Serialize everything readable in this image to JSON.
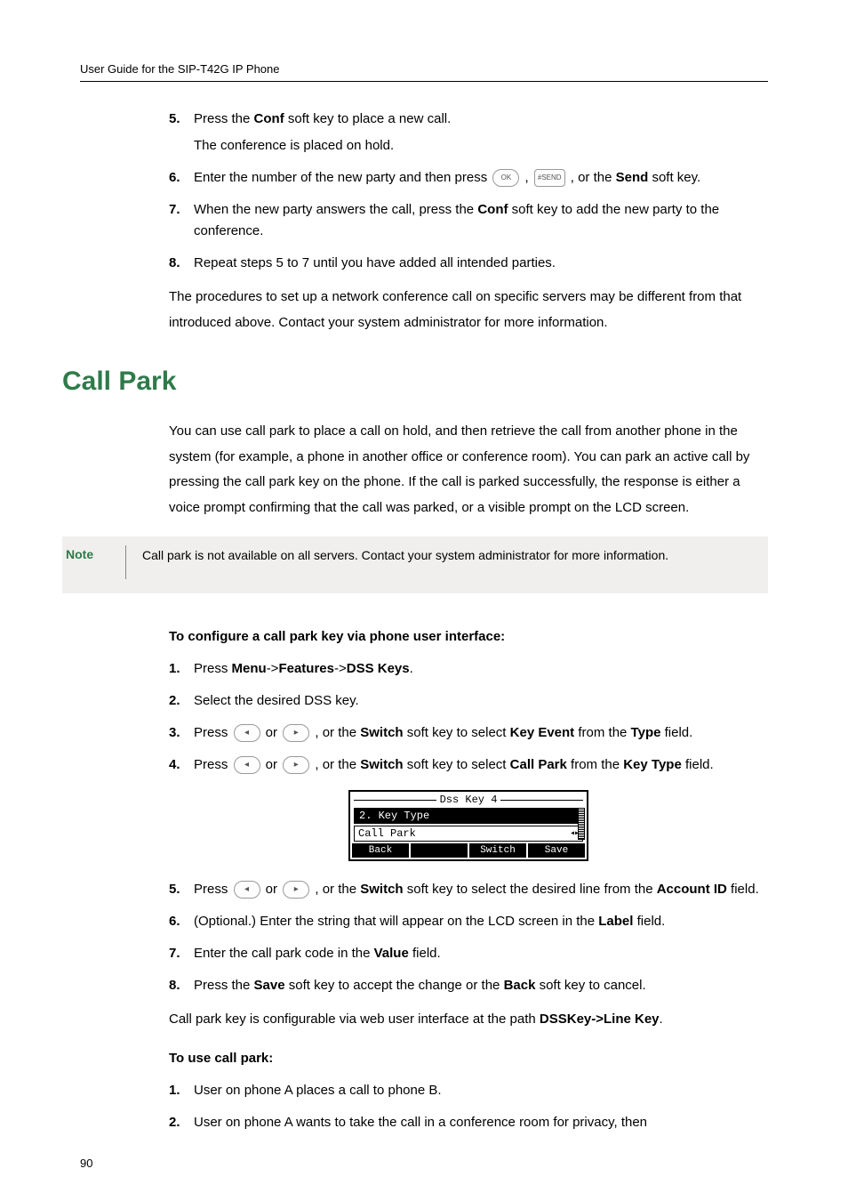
{
  "header": {
    "title": "User Guide for the SIP-T42G IP Phone"
  },
  "top_steps": {
    "s5": {
      "num": "5.",
      "a": "Press the ",
      "b": "Conf",
      "c": " soft key to place a new call.",
      "sub": "The conference is placed on hold."
    },
    "s6": {
      "num": "6.",
      "a": "Enter the number of the new party and then press ",
      "mid": " , ",
      "b": " , or the ",
      "c": "Send",
      "d": " soft key."
    },
    "s7": {
      "num": "7.",
      "a": "When the new party answers the call, press the ",
      "b": "Conf",
      "c": " soft key to add the new party to the conference."
    },
    "s8": {
      "num": "8.",
      "text": "Repeat steps 5 to 7 until you have added all intended parties."
    }
  },
  "top_para": "The procedures to set up a network conference call on specific servers may be different from that introduced above. Contact your system administrator for more information.",
  "h2": "Call Park",
  "cp_para": "You can use call park to place a call on hold, and then retrieve the call from another phone in the system (for example, a phone in another office or conference room). You can park an active call by pressing the call park key on the phone. If the call is parked successfully, the response is either a voice prompt confirming that the call was parked, or a visible prompt on the LCD screen.",
  "note": {
    "label": "Note",
    "text": "Call park is not available on all servers. Contact your system administrator for more information."
  },
  "cfg_title": "To configure a call park key via phone user interface:",
  "cfg_steps": {
    "s1": {
      "num": "1.",
      "a": "Press ",
      "b": "Menu",
      "c": "->",
      "d": "Features",
      "e": "->",
      "f": "DSS Keys",
      "g": "."
    },
    "s2": {
      "num": "2.",
      "text": "Select the desired DSS key."
    },
    "s3": {
      "num": "3.",
      "a": "Press ",
      "mid": " or ",
      "b": " , or the ",
      "c": "Switch",
      "d": " soft key to select ",
      "e": "Key Event",
      "f": " from the ",
      "g": "Type",
      "h": " field."
    },
    "s4": {
      "num": "4.",
      "a": "Press ",
      "mid": " or ",
      "b": " , or the ",
      "c": "Switch",
      "d": " soft key to select ",
      "e": "Call Park",
      "f": " from the ",
      "g": "Key Type",
      "h": " field."
    },
    "s5": {
      "num": "5.",
      "a": "Press ",
      "mid": " or ",
      "b": " , or the ",
      "c": "Switch",
      "d": " soft key to select the desired line from the ",
      "e": "Account ID",
      "f": " field."
    },
    "s6": {
      "num": "6.",
      "a": "(Optional.) Enter the string that will appear on the LCD screen in the ",
      "b": "Label",
      "c": " field."
    },
    "s7": {
      "num": "7.",
      "a": "Enter the call park code in the ",
      "b": "Value",
      "c": " field."
    },
    "s8": {
      "num": "8.",
      "a": "Press the ",
      "b": "Save",
      "c": " soft key to accept the change or the ",
      "d": "Back",
      "e": " soft key to cancel."
    }
  },
  "lcd": {
    "title": "Dss Key 4",
    "field_label": "2. Key Type",
    "field_value": "Call Park",
    "sk1": "Back",
    "sk2": "",
    "sk3": "Switch",
    "sk4": "Save"
  },
  "cfg_para": {
    "a": "Call park key is configurable via web user interface at the path ",
    "b": "DSSKey->Line Key",
    "c": "."
  },
  "use_title": "To use call park:",
  "use_steps": {
    "s1": {
      "num": "1.",
      "text": "User on phone A places a call to phone B."
    },
    "s2": {
      "num": "2.",
      "text": "User on phone A wants to take the call in a conference room for privacy, then"
    }
  },
  "icons": {
    "ok": "OK",
    "hash": "#SEND",
    "left": "◂",
    "right": "▸",
    "lr": "◂▸"
  },
  "page_num": "90"
}
